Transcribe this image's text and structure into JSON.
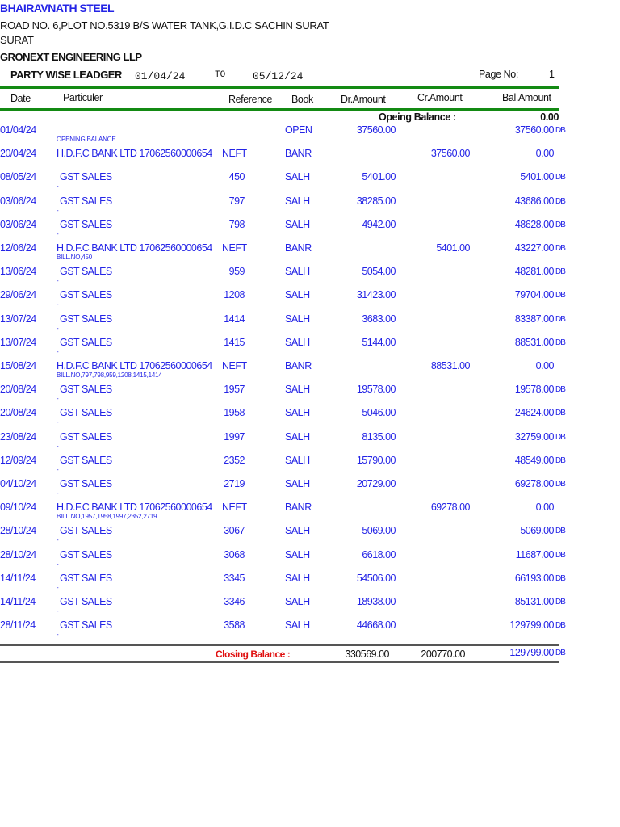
{
  "company": {
    "name": "BHAIRAVNATH STEEL",
    "address1": "ROAD NO. 6,PLOT NO.5319  B/S WATER TANK,G.I.D.C SACHIN  SURAT",
    "address2": "SURAT"
  },
  "party": "GRONEXT ENGINEERING LLP",
  "report": {
    "title": "PARTY WISE LEADGER",
    "from": "01/04/24",
    "to_label": "TO",
    "to": "05/12/24",
    "page_label": "Page No:",
    "page": "1"
  },
  "columns": [
    "Date",
    "Particuler",
    "Reference",
    "Book",
    "Dr.Amount",
    "Cr.Amount",
    "Bal.Amount"
  ],
  "opening": {
    "label": "Opeing Balance :",
    "value": "0.00"
  },
  "rows": [
    {
      "date": "01/04/24",
      "part": "",
      "narr": "OPENING BALANCE",
      "ref": "",
      "book": "OPEN",
      "dr": "37560.00",
      "cr": "",
      "bal": "37560.00",
      "sfx": "DB"
    },
    {
      "date": "20/04/24",
      "part": "H.D.F.C BANK LTD 17062560000654",
      "narr": "",
      "ref": "NEFT",
      "book": "BANR",
      "dr": "",
      "cr": "37560.00",
      "bal": "0.00",
      "sfx": ""
    },
    {
      "date": "08/05/24",
      "part": "GST SALES",
      "narr": "-",
      "ref": "450",
      "book": "SALH",
      "dr": "5401.00",
      "cr": "",
      "bal": "5401.00",
      "sfx": "DB"
    },
    {
      "date": "03/06/24",
      "part": "GST SALES",
      "narr": "-",
      "ref": "797",
      "book": "SALH",
      "dr": "38285.00",
      "cr": "",
      "bal": "43686.00",
      "sfx": "DB"
    },
    {
      "date": "03/06/24",
      "part": "GST SALES",
      "narr": "-",
      "ref": "798",
      "book": "SALH",
      "dr": "4942.00",
      "cr": "",
      "bal": "48628.00",
      "sfx": "DB"
    },
    {
      "date": "12/06/24",
      "part": "H.D.F.C BANK LTD 17062560000654",
      "narr": "BILL.NO,450",
      "ref": "NEFT",
      "book": "BANR",
      "dr": "",
      "cr": "5401.00",
      "bal": "43227.00",
      "sfx": "DB"
    },
    {
      "date": "13/06/24",
      "part": "GST SALES",
      "narr": "-",
      "ref": "959",
      "book": "SALH",
      "dr": "5054.00",
      "cr": "",
      "bal": "48281.00",
      "sfx": "DB"
    },
    {
      "date": "29/06/24",
      "part": "GST SALES",
      "narr": "-",
      "ref": "1208",
      "book": "SALH",
      "dr": "31423.00",
      "cr": "",
      "bal": "79704.00",
      "sfx": "DB"
    },
    {
      "date": "13/07/24",
      "part": "GST SALES",
      "narr": "-",
      "ref": "1414",
      "book": "SALH",
      "dr": "3683.00",
      "cr": "",
      "bal": "83387.00",
      "sfx": "DB"
    },
    {
      "date": "13/07/24",
      "part": "GST SALES",
      "narr": "-",
      "ref": "1415",
      "book": "SALH",
      "dr": "5144.00",
      "cr": "",
      "bal": "88531.00",
      "sfx": "DB"
    },
    {
      "date": "15/08/24",
      "part": "H.D.F.C BANK LTD 17062560000654",
      "narr": "BILL.NO,797,798,959,1208,1415,1414",
      "ref": "NEFT",
      "book": "BANR",
      "dr": "",
      "cr": "88531.00",
      "bal": "0.00",
      "sfx": ""
    },
    {
      "date": "20/08/24",
      "part": "GST SALES",
      "narr": "-",
      "ref": "1957",
      "book": "SALH",
      "dr": "19578.00",
      "cr": "",
      "bal": "19578.00",
      "sfx": "DB"
    },
    {
      "date": "20/08/24",
      "part": "GST SALES",
      "narr": "-",
      "ref": "1958",
      "book": "SALH",
      "dr": "5046.00",
      "cr": "",
      "bal": "24624.00",
      "sfx": "DB"
    },
    {
      "date": "23/08/24",
      "part": "GST SALES",
      "narr": "-",
      "ref": "1997",
      "book": "SALH",
      "dr": "8135.00",
      "cr": "",
      "bal": "32759.00",
      "sfx": "DB"
    },
    {
      "date": "12/09/24",
      "part": "GST SALES",
      "narr": "-",
      "ref": "2352",
      "book": "SALH",
      "dr": "15790.00",
      "cr": "",
      "bal": "48549.00",
      "sfx": "DB"
    },
    {
      "date": "04/10/24",
      "part": "GST SALES",
      "narr": "-",
      "ref": "2719",
      "book": "SALH",
      "dr": "20729.00",
      "cr": "",
      "bal": "69278.00",
      "sfx": "DB"
    },
    {
      "date": "09/10/24",
      "part": "H.D.F.C BANK LTD 17062560000654",
      "narr": "BILL.NO,1957,1958,1997,2352,2719",
      "ref": "NEFT",
      "book": "BANR",
      "dr": "",
      "cr": "69278.00",
      "bal": "0.00",
      "sfx": ""
    },
    {
      "date": "28/10/24",
      "part": "GST SALES",
      "narr": "-",
      "ref": "3067",
      "book": "SALH",
      "dr": "5069.00",
      "cr": "",
      "bal": "5069.00",
      "sfx": "DB"
    },
    {
      "date": "28/10/24",
      "part": "GST SALES",
      "narr": "-",
      "ref": "3068",
      "book": "SALH",
      "dr": "6618.00",
      "cr": "",
      "bal": "11687.00",
      "sfx": "DB"
    },
    {
      "date": "14/11/24",
      "part": "GST SALES",
      "narr": "-",
      "ref": "3345",
      "book": "SALH",
      "dr": "54506.00",
      "cr": "",
      "bal": "66193.00",
      "sfx": "DB"
    },
    {
      "date": "14/11/24",
      "part": "GST SALES",
      "narr": "-",
      "ref": "3346",
      "book": "SALH",
      "dr": "18938.00",
      "cr": "",
      "bal": "85131.00",
      "sfx": "DB"
    },
    {
      "date": "28/11/24",
      "part": "GST SALES",
      "narr": "-",
      "ref": "3588",
      "book": "SALH",
      "dr": "44668.00",
      "cr": "",
      "bal": "129799.00",
      "sfx": "DB"
    }
  ],
  "closing": {
    "label": "Closing Balance :",
    "dr": "330569.00",
    "cr": "200770.00",
    "bal": "129799.00",
    "sfx": "DB"
  },
  "colors": {
    "text_blue": "#2424e6",
    "rule_green": "#138a13",
    "closing_red": "#e01010"
  }
}
